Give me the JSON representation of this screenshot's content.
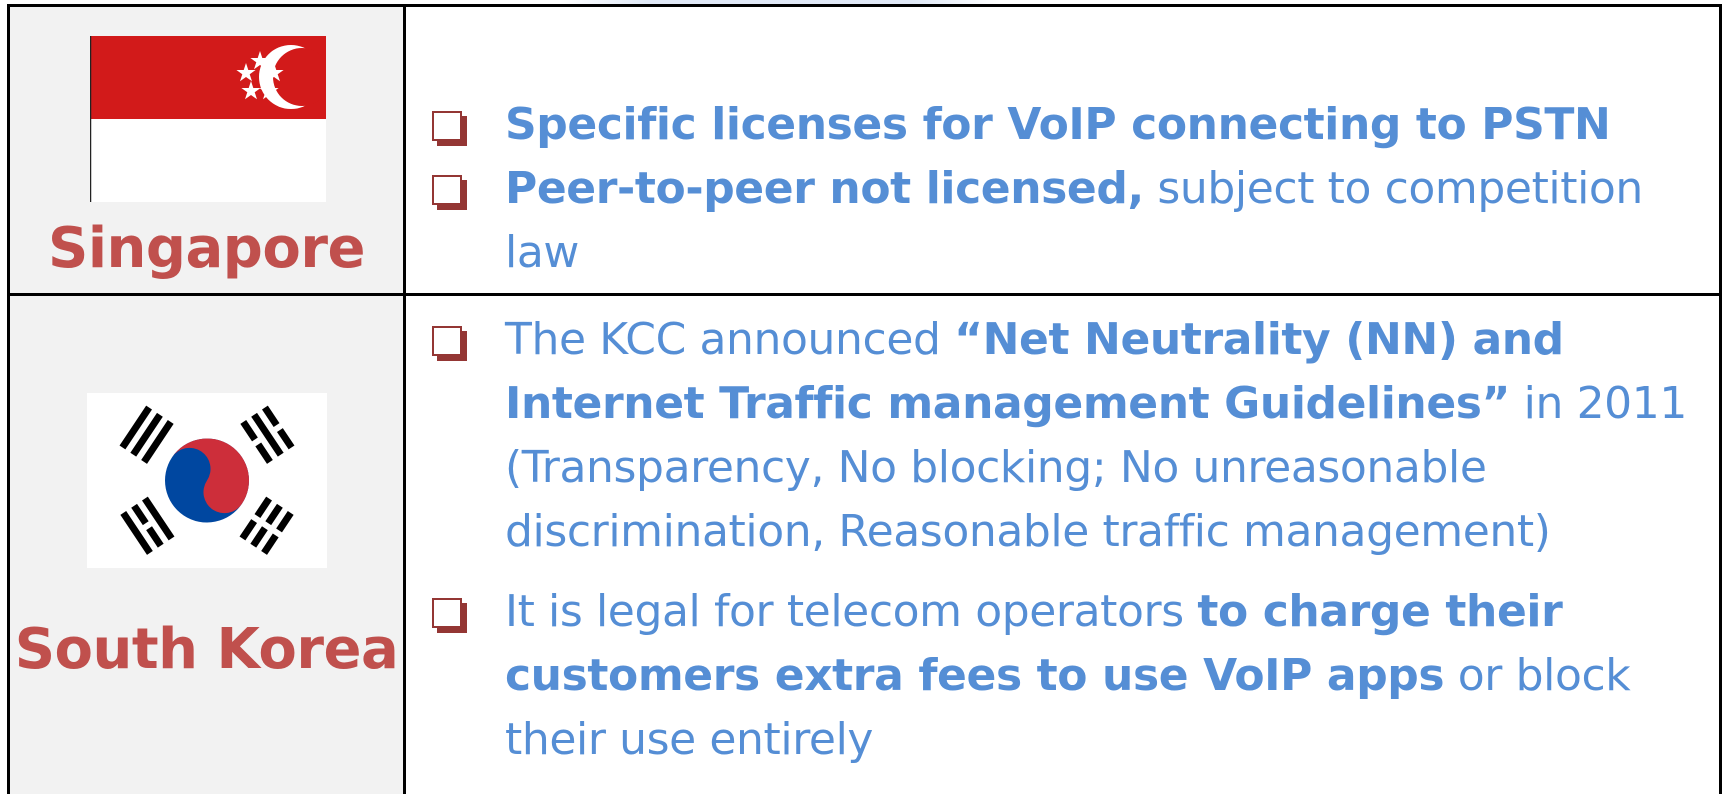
{
  "colors": {
    "country_name": "#c0504d",
    "bullet_text": "#558ed5",
    "checkbox": "#943634",
    "country_cell_bg": "#f2f2f2",
    "border": "#000000"
  },
  "rows": [
    {
      "country": "Singapore",
      "flag": "singapore-flag",
      "bullets": [
        {
          "parts": [
            {
              "text": "Specific licenses for VoIP connecting to PSTN",
              "bold": true
            }
          ]
        },
        {
          "parts": [
            {
              "text": "Peer-to-peer not licensed,",
              "bold": true
            },
            {
              "text": " subject to competition law",
              "bold": false
            }
          ]
        }
      ]
    },
    {
      "country": "South Korea",
      "flag": "south-korea-flag",
      "bullets": [
        {
          "parts": [
            {
              "text": "The KCC announced ",
              "bold": false
            },
            {
              "text": "“Net Neutrality (NN) and Internet Traffic management  Guidelines”",
              "bold": true
            },
            {
              "text": " in 2011 (Transparency, No blocking; No unreasonable discrimination, Reasonable traffic management)",
              "bold": false
            }
          ]
        },
        {
          "parts": [
            {
              "text": "It is legal for telecom operators ",
              "bold": false
            },
            {
              "text": "to charge their customers extra fees to use VoIP apps",
              "bold": true
            },
            {
              "text": " or block their use entirely",
              "bold": false
            }
          ]
        }
      ]
    }
  ]
}
